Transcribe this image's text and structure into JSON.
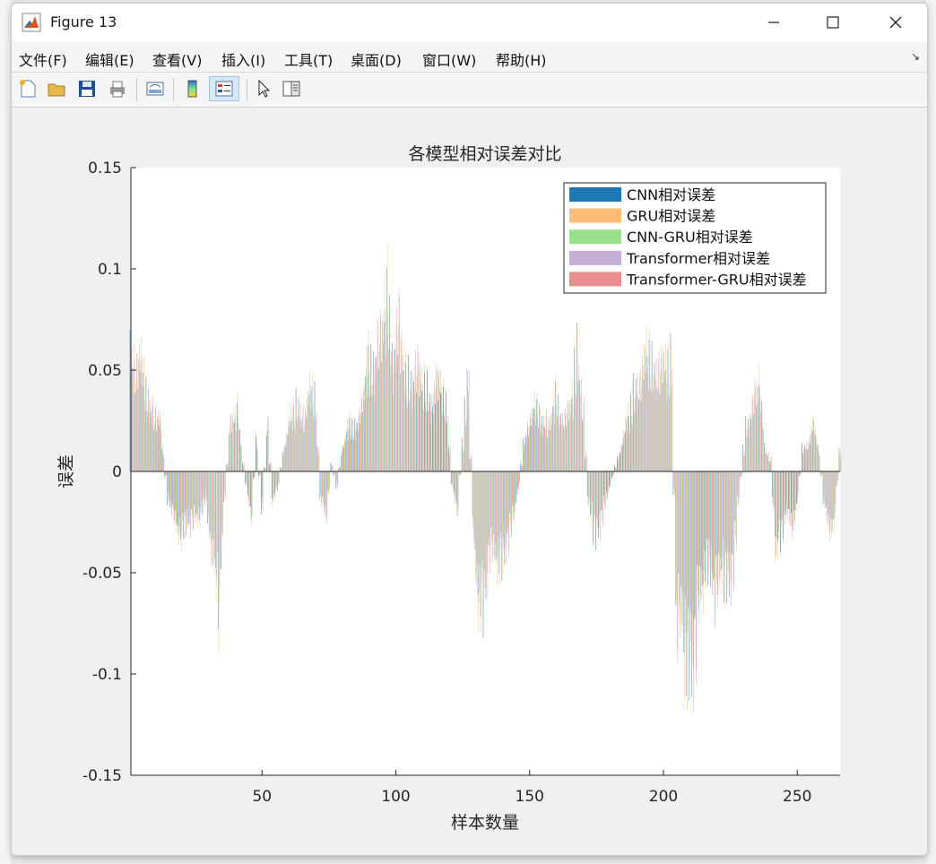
{
  "window": {
    "title": "Figure 13"
  },
  "menu": [
    "文件(F)",
    "编辑(E)",
    "查看(V)",
    "插入(I)",
    "工具(T)",
    "桌面(D)",
    "窗口(W)",
    "帮助(H)"
  ],
  "toolbar": {
    "icons": [
      "new-figure-icon",
      "open-file-icon",
      "save-icon",
      "print-icon",
      "link-plot-icon",
      "colorbar-icon",
      "legend-icon",
      "pointer-icon",
      "property-editor-icon"
    ]
  },
  "colors": {
    "cnn": "#1f77b4",
    "gru": "#ffbb78",
    "cnn_gru": "#98df8a",
    "transformer": "#c5b0d5",
    "transformer_gru": "#e8908f"
  },
  "chart_data": {
    "type": "bar",
    "title": "各模型相对误差对比",
    "xlabel": "样本数量",
    "ylabel": "误差",
    "xlim": [
      1,
      266
    ],
    "ylim": [
      -0.15,
      0.15
    ],
    "xticks": [
      "50",
      "100",
      "150",
      "200",
      "250"
    ],
    "yticks": [
      "0.15",
      "0.1",
      "0.05",
      "0",
      "-0.05",
      "-0.1",
      "-0.15"
    ],
    "legend_position": "top-right",
    "series_names": [
      "CNN相对误差",
      "GRU相对误差",
      "CNN-GRU相对误差",
      "Transformer相对误差",
      "Transformer-GRU相对误差"
    ],
    "envelope_points": [
      [
        1,
        0.075
      ],
      [
        5,
        0.07
      ],
      [
        8,
        0.045
      ],
      [
        12,
        0.03
      ],
      [
        15,
        -0.02
      ],
      [
        18,
        -0.035
      ],
      [
        22,
        -0.038
      ],
      [
        26,
        -0.03
      ],
      [
        29,
        -0.02
      ],
      [
        31,
        -0.05
      ],
      [
        33,
        -0.07
      ],
      [
        34,
        -0.088
      ],
      [
        36,
        -0.02
      ],
      [
        38,
        0.03
      ],
      [
        41,
        0.037
      ],
      [
        44,
        -0.01
      ],
      [
        46,
        -0.03
      ],
      [
        48,
        0.02
      ],
      [
        50,
        -0.025
      ],
      [
        52,
        0.03
      ],
      [
        54,
        -0.02
      ],
      [
        56,
        -0.01
      ],
      [
        58,
        0.015
      ],
      [
        60,
        0.028
      ],
      [
        63,
        0.045
      ],
      [
        66,
        0.038
      ],
      [
        68,
        0.05
      ],
      [
        70,
        0.048
      ],
      [
        72,
        -0.02
      ],
      [
        74,
        -0.03
      ],
      [
        76,
        0.005
      ],
      [
        78,
        -0.01
      ],
      [
        80,
        0.015
      ],
      [
        83,
        0.03
      ],
      [
        86,
        0.035
      ],
      [
        89,
        0.06
      ],
      [
        92,
        0.075
      ],
      [
        95,
        0.1
      ],
      [
        97,
        0.108
      ],
      [
        99,
        0.08
      ],
      [
        101,
        0.095
      ],
      [
        104,
        0.06
      ],
      [
        107,
        0.07
      ],
      [
        110,
        0.055
      ],
      [
        113,
        0.05
      ],
      [
        115,
        0.06
      ],
      [
        117,
        0.055
      ],
      [
        119,
        0.04
      ],
      [
        121,
        -0.01
      ],
      [
        123,
        -0.025
      ],
      [
        125,
        0.02
      ],
      [
        127,
        0.06
      ],
      [
        129,
        -0.04
      ],
      [
        131,
        -0.078
      ],
      [
        133,
        -0.093
      ],
      [
        135,
        -0.06
      ],
      [
        137,
        -0.05
      ],
      [
        140,
        -0.06
      ],
      [
        143,
        -0.04
      ],
      [
        146,
        -0.01
      ],
      [
        148,
        0.02
      ],
      [
        151,
        0.038
      ],
      [
        154,
        0.04
      ],
      [
        157,
        0.03
      ],
      [
        160,
        0.045
      ],
      [
        163,
        0.035
      ],
      [
        166,
        0.05
      ],
      [
        168,
        0.078
      ],
      [
        170,
        0.04
      ],
      [
        172,
        -0.02
      ],
      [
        174,
        -0.04
      ],
      [
        176,
        -0.045
      ],
      [
        178,
        -0.02
      ],
      [
        180,
        -0.01
      ],
      [
        183,
        0.01
      ],
      [
        186,
        0.03
      ],
      [
        189,
        0.05
      ],
      [
        192,
        0.065
      ],
      [
        195,
        0.08
      ],
      [
        197,
        0.065
      ],
      [
        199,
        0.07
      ],
      [
        201,
        0.06
      ],
      [
        203,
        0.08
      ],
      [
        205,
        -0.11
      ],
      [
        207,
        -0.09
      ],
      [
        209,
        -0.12
      ],
      [
        211,
        -0.138
      ],
      [
        213,
        -0.09
      ],
      [
        216,
        -0.06
      ],
      [
        219,
        -0.08
      ],
      [
        222,
        -0.06
      ],
      [
        225,
        -0.088
      ],
      [
        228,
        -0.02
      ],
      [
        231,
        0.03
      ],
      [
        234,
        0.05
      ],
      [
        236,
        0.058
      ],
      [
        238,
        0.015
      ],
      [
        240,
        0.008
      ],
      [
        242,
        -0.05
      ],
      [
        244,
        -0.045
      ],
      [
        246,
        -0.03
      ],
      [
        248,
        -0.035
      ],
      [
        250,
        -0.02
      ],
      [
        252,
        0.015
      ],
      [
        254,
        0.02
      ],
      [
        256,
        0.03
      ],
      [
        258,
        0.015
      ],
      [
        260,
        -0.02
      ],
      [
        262,
        -0.04
      ],
      [
        264,
        -0.03
      ],
      [
        266,
        0.013
      ]
    ]
  }
}
